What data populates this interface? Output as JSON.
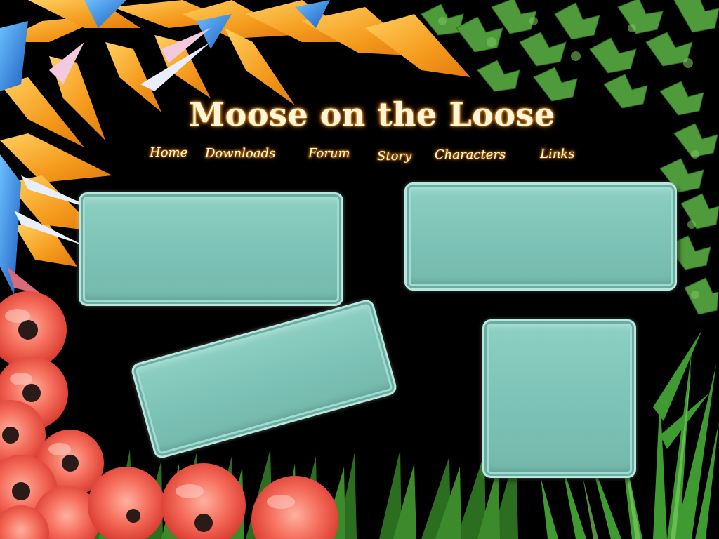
{
  "site": {
    "title": "Moose on the Loose"
  },
  "nav": {
    "items": [
      {
        "id": "home",
        "label": "Home"
      },
      {
        "id": "downloads",
        "label": "Downloads"
      },
      {
        "id": "forum",
        "label": "Forum"
      },
      {
        "id": "story",
        "label": "Story"
      },
      {
        "id": "characters",
        "label": "Characters"
      },
      {
        "id": "links",
        "label": "Links"
      }
    ]
  },
  "panels": [
    {
      "id": "top-left",
      "content": ""
    },
    {
      "id": "top-right",
      "content": ""
    },
    {
      "id": "bottom-left-tilted",
      "content": ""
    },
    {
      "id": "bottom-right",
      "content": ""
    }
  ],
  "colors": {
    "background": "#000000",
    "panel_fill": "#7fc4b8",
    "panel_border": "#b9e6dd",
    "title_glow": "#e08a18",
    "title_text": "#fff6da",
    "foliage_ivy": "#4f9a3a",
    "bird_of_paradise_orange": "#f6a021",
    "bird_of_paradise_blue": "#2f7fd8",
    "tulip_coral": "#f0584a",
    "grass": "#2f7a24"
  },
  "decorations": [
    {
      "name": "bird-of-paradise-flowers",
      "position": "top-left"
    },
    {
      "name": "ivy-leaves",
      "position": "right"
    },
    {
      "name": "coral-tulips",
      "position": "bottom-left"
    },
    {
      "name": "spiky-green-plants",
      "position": "bottom-right"
    },
    {
      "name": "grass",
      "position": "bottom"
    }
  ]
}
